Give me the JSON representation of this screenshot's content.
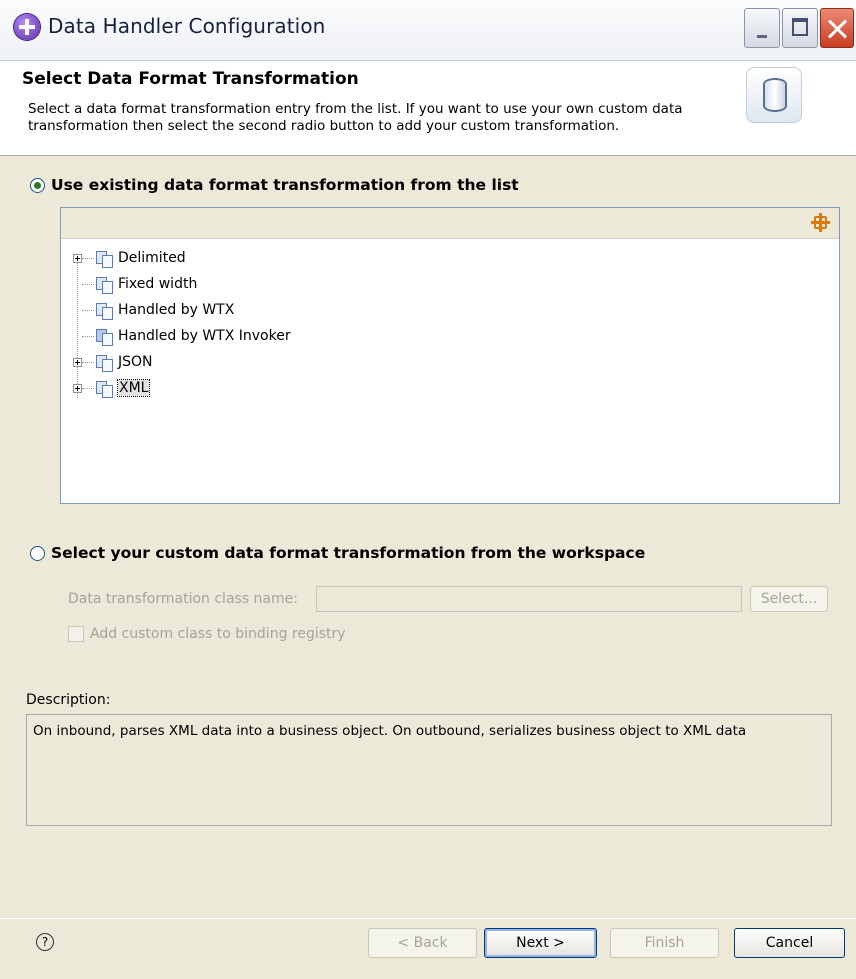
{
  "window": {
    "title": "Data Handler Configuration"
  },
  "header": {
    "title": "Select Data Format Transformation",
    "description": "Select a data format transformation entry from the list.  If you want to use your own custom data transformation then select the second radio button to add your custom transformation."
  },
  "option_existing": {
    "label": "Use existing data format transformation from the list",
    "selected": true
  },
  "tree": {
    "items": [
      {
        "label": "Delimited",
        "expandable": true
      },
      {
        "label": "Fixed width",
        "expandable": false
      },
      {
        "label": "Handled by WTX",
        "expandable": false
      },
      {
        "label": "Handled by WTX Invoker",
        "expandable": false
      },
      {
        "label": "JSON",
        "expandable": true
      },
      {
        "label": "XML",
        "expandable": true,
        "selected": true
      }
    ]
  },
  "option_custom": {
    "label": "Select your custom data format transformation from the workspace",
    "selected": false,
    "class_name_label": "Data transformation class name:",
    "class_name_value": "",
    "select_button": "Select...",
    "checkbox_label": "Add custom class to binding registry"
  },
  "description": {
    "label": "Description:",
    "text": "On inbound, parses XML data into a business object. On outbound, serializes business object to XML data"
  },
  "footer": {
    "back": "< Back",
    "next": "Next >",
    "finish": "Finish",
    "cancel": "Cancel",
    "help_icon": "?"
  },
  "icons": {
    "app": "eclipse-plugin-icon",
    "banner": "data-cylinder-icon",
    "tree_node": "transformation-icon",
    "filter": "filter-icon",
    "help": "help-icon"
  }
}
